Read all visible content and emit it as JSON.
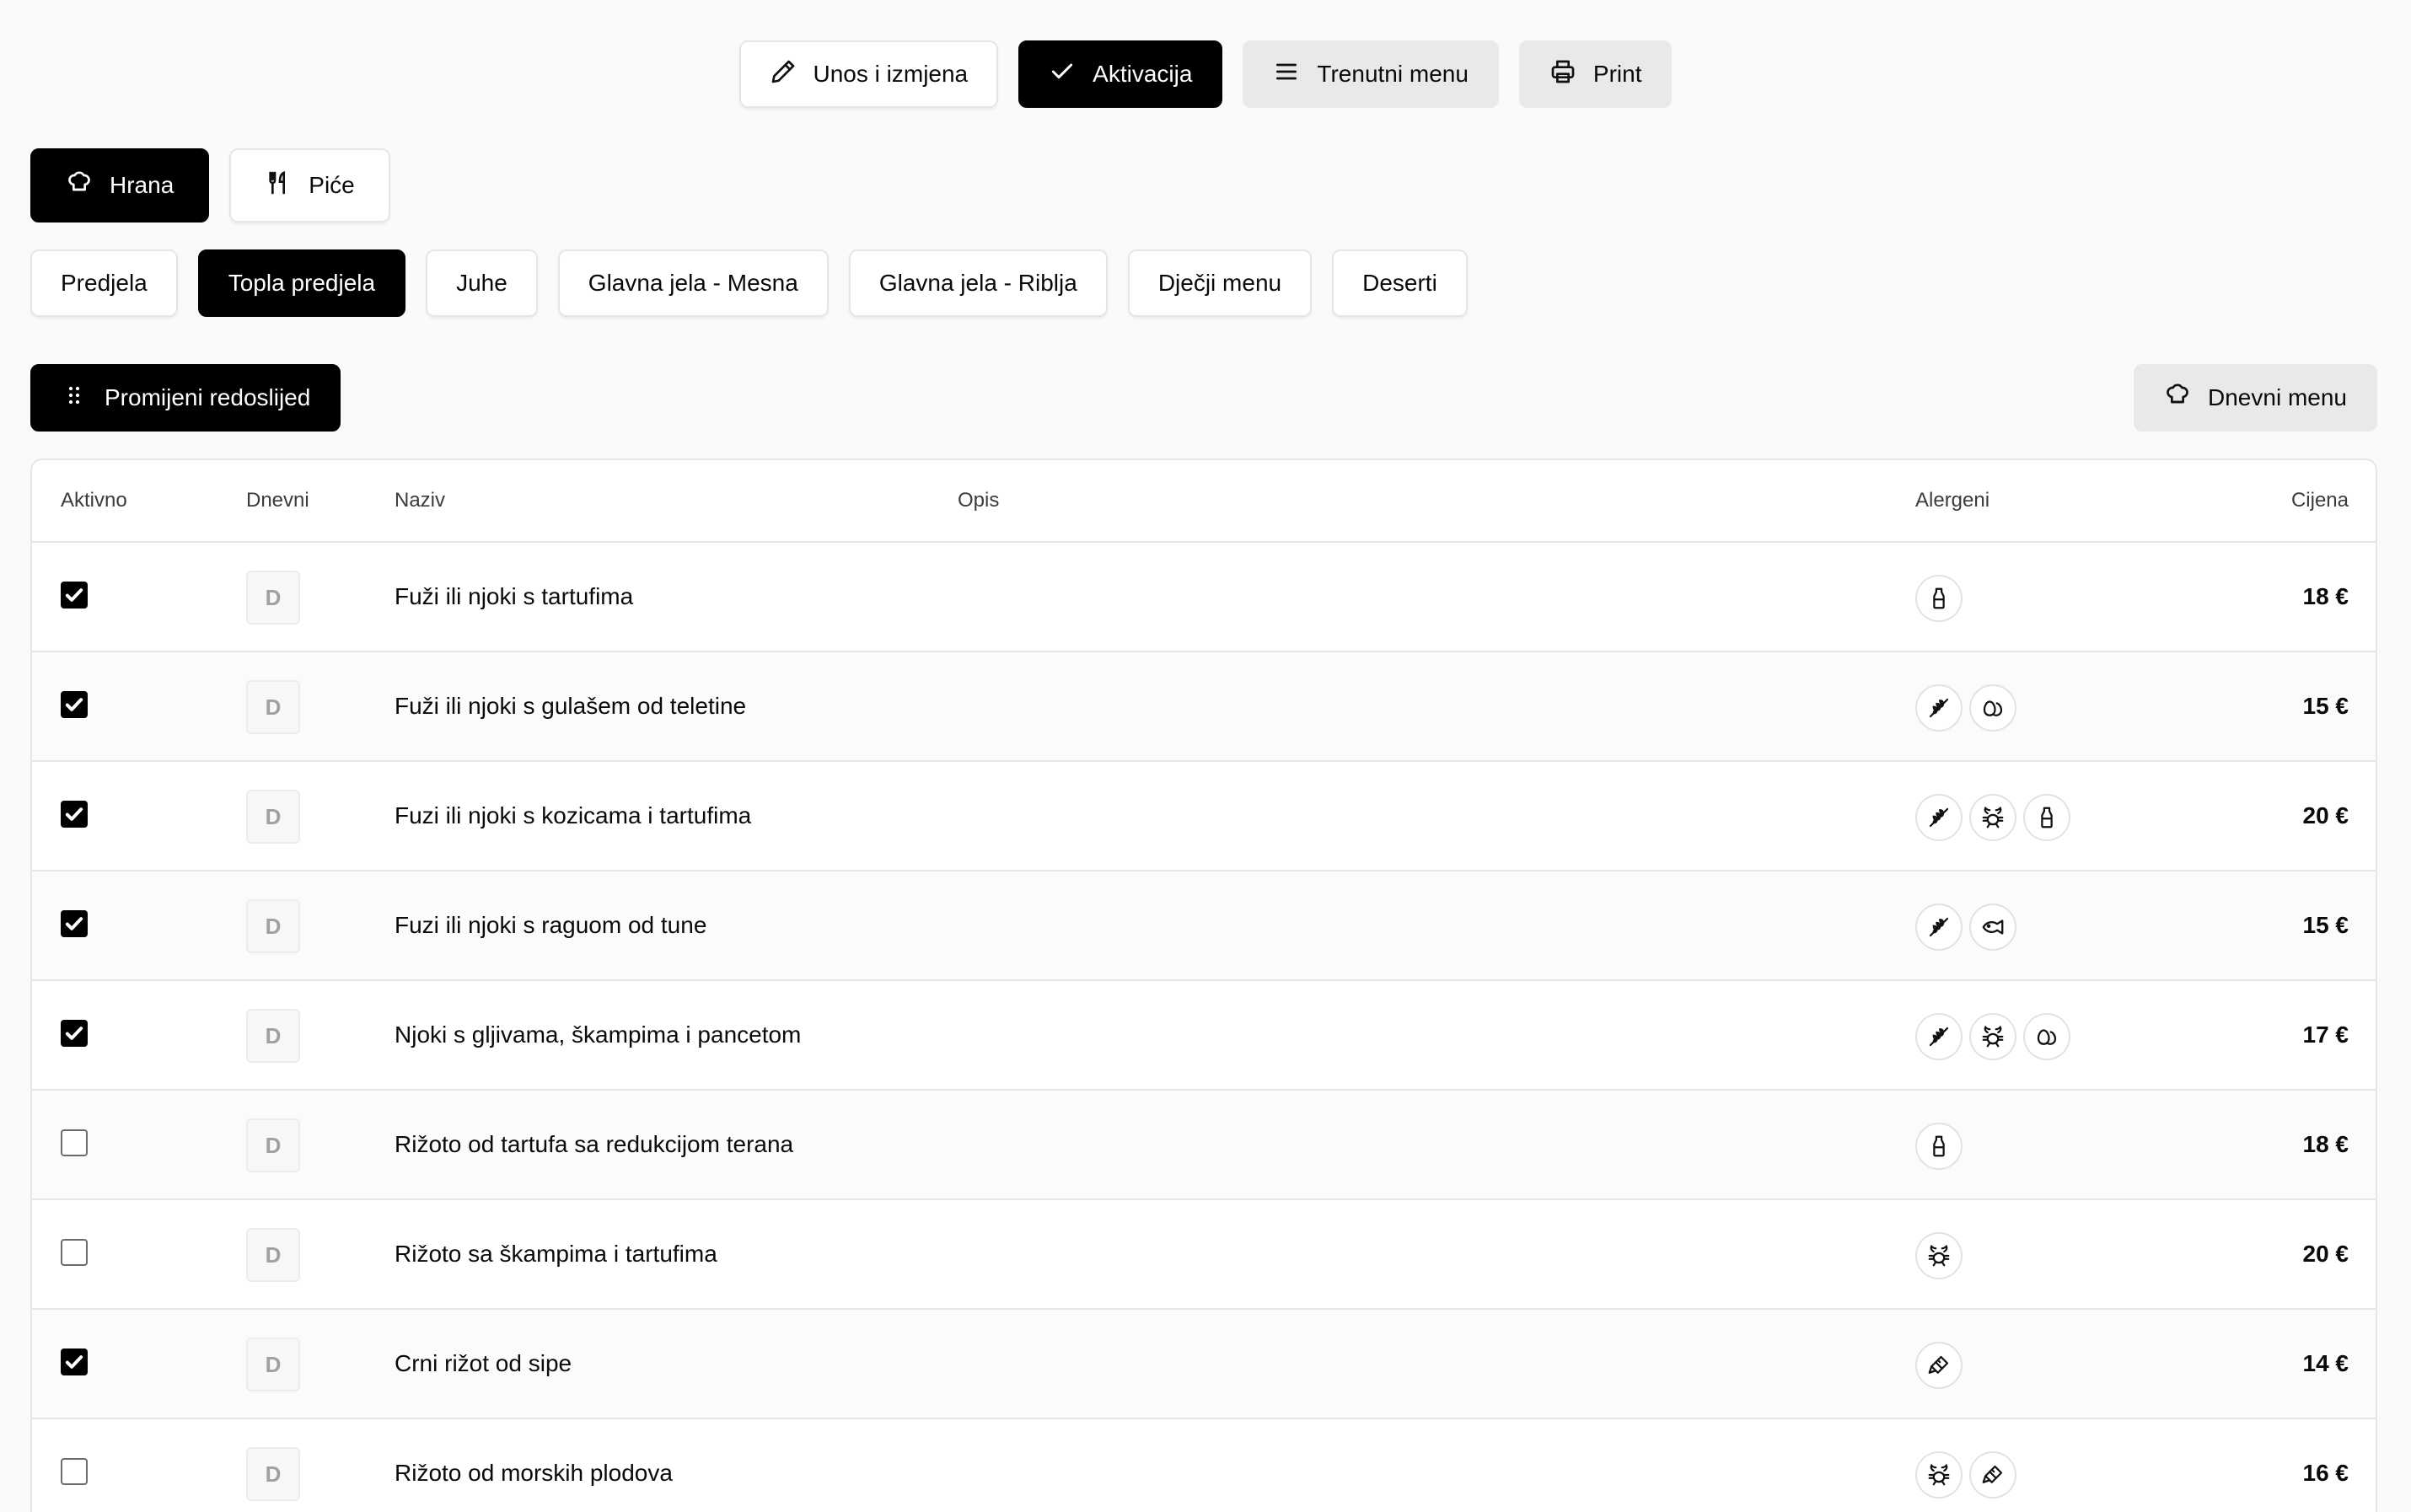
{
  "toolbar": {
    "edit_label": "Unos i izmjena",
    "activation_label": "Aktivacija",
    "current_menu_label": "Trenutni menu",
    "print_label": "Print"
  },
  "type_tabs": {
    "food_label": "Hrana",
    "drinks_label": "Piće",
    "active": "Hrana"
  },
  "categories": {
    "items": [
      "Predjela",
      "Topla predjela",
      "Juhe",
      "Glavna jela - Mesna",
      "Glavna jela - Riblja",
      "Dječji menu",
      "Deserti"
    ],
    "active": "Topla predjela"
  },
  "actions": {
    "reorder_label": "Promijeni redoslijed",
    "daily_menu_label": "Dnevni menu"
  },
  "table": {
    "headers": {
      "active": "Aktivno",
      "daily": "Dnevni",
      "name": "Naziv",
      "description": "Opis",
      "allergens": "Alergeni",
      "price": "Cijena"
    },
    "daily_badge": "D",
    "rows": [
      {
        "active": true,
        "name": "Fuži ili njoki s tartufima",
        "allergens": [
          "milk-icon"
        ],
        "price": "18 €"
      },
      {
        "active": true,
        "name": "Fuži ili njoki s gulašem od teletine",
        "allergens": [
          "gluten-icon",
          "egg-icon"
        ],
        "price": "15 €"
      },
      {
        "active": true,
        "name": "Fuzi ili njoki s kozicama i tartufima",
        "allergens": [
          "gluten-icon",
          "crustacean-icon",
          "milk-icon"
        ],
        "price": "20 €"
      },
      {
        "active": true,
        "name": "Fuzi ili njoki s raguom od tune",
        "allergens": [
          "gluten-icon",
          "fish-icon"
        ],
        "price": "15 €"
      },
      {
        "active": true,
        "name": "Njoki s gljivama, škampima i pancetom",
        "allergens": [
          "gluten-icon",
          "crustacean-icon",
          "egg-icon"
        ],
        "price": "17 €"
      },
      {
        "active": false,
        "name": "Rižoto od tartufa sa redukcijom terana",
        "allergens": [
          "milk-icon"
        ],
        "price": "18 €"
      },
      {
        "active": false,
        "name": "Rižoto sa škampima i tartufima",
        "allergens": [
          "crustacean-icon"
        ],
        "price": "20 €"
      },
      {
        "active": true,
        "name": "Crni rižot od sipe",
        "allergens": [
          "mollusc-icon"
        ],
        "price": "14 €"
      },
      {
        "active": false,
        "name": "Rižoto od morskih plodova",
        "allergens": [
          "crustacean-icon",
          "mollusc-icon"
        ],
        "price": "16 €"
      }
    ]
  },
  "colors": {
    "background": "#fafafa",
    "dark_button": "#000000",
    "gray_button": "#e9e9e9",
    "border": "#e6e6e6"
  }
}
